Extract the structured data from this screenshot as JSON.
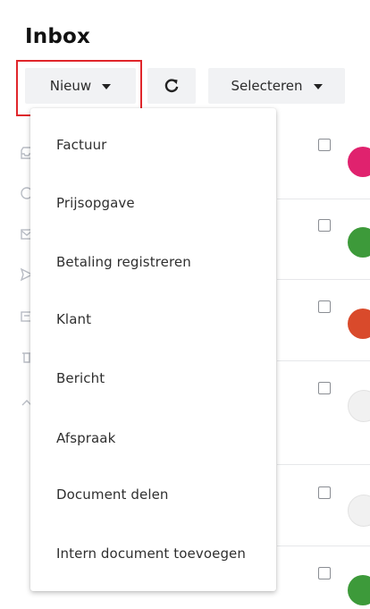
{
  "header": {
    "title": "Inbox"
  },
  "toolbar": {
    "new_label": "Nieuw",
    "refresh_icon": "refresh-icon",
    "select_label": "Selecteren"
  },
  "dropdown": {
    "items": [
      {
        "label": "Factuur"
      },
      {
        "label": "Prijsopgave"
      },
      {
        "label": "Betaling registreren"
      },
      {
        "label": "Klant"
      },
      {
        "label": "Bericht"
      },
      {
        "label": "Afspraak"
      },
      {
        "label": "Document delen"
      },
      {
        "label": "Intern document toevoegen"
      }
    ]
  },
  "sidebar": {
    "icons": [
      "inbox-icon",
      "clock-icon",
      "mail-icon",
      "send-icon",
      "archive-icon",
      "trash-icon",
      "chevron-up-icon"
    ]
  },
  "list": {
    "avatar_colors": [
      "#e0226e",
      "#3d9a3a",
      "#d94a2b",
      "#e8e8e8",
      "#e8e8e8",
      "#3d9a3a"
    ]
  },
  "colors": {
    "highlight": "#e0262b",
    "button_bg": "#f1f2f4"
  }
}
